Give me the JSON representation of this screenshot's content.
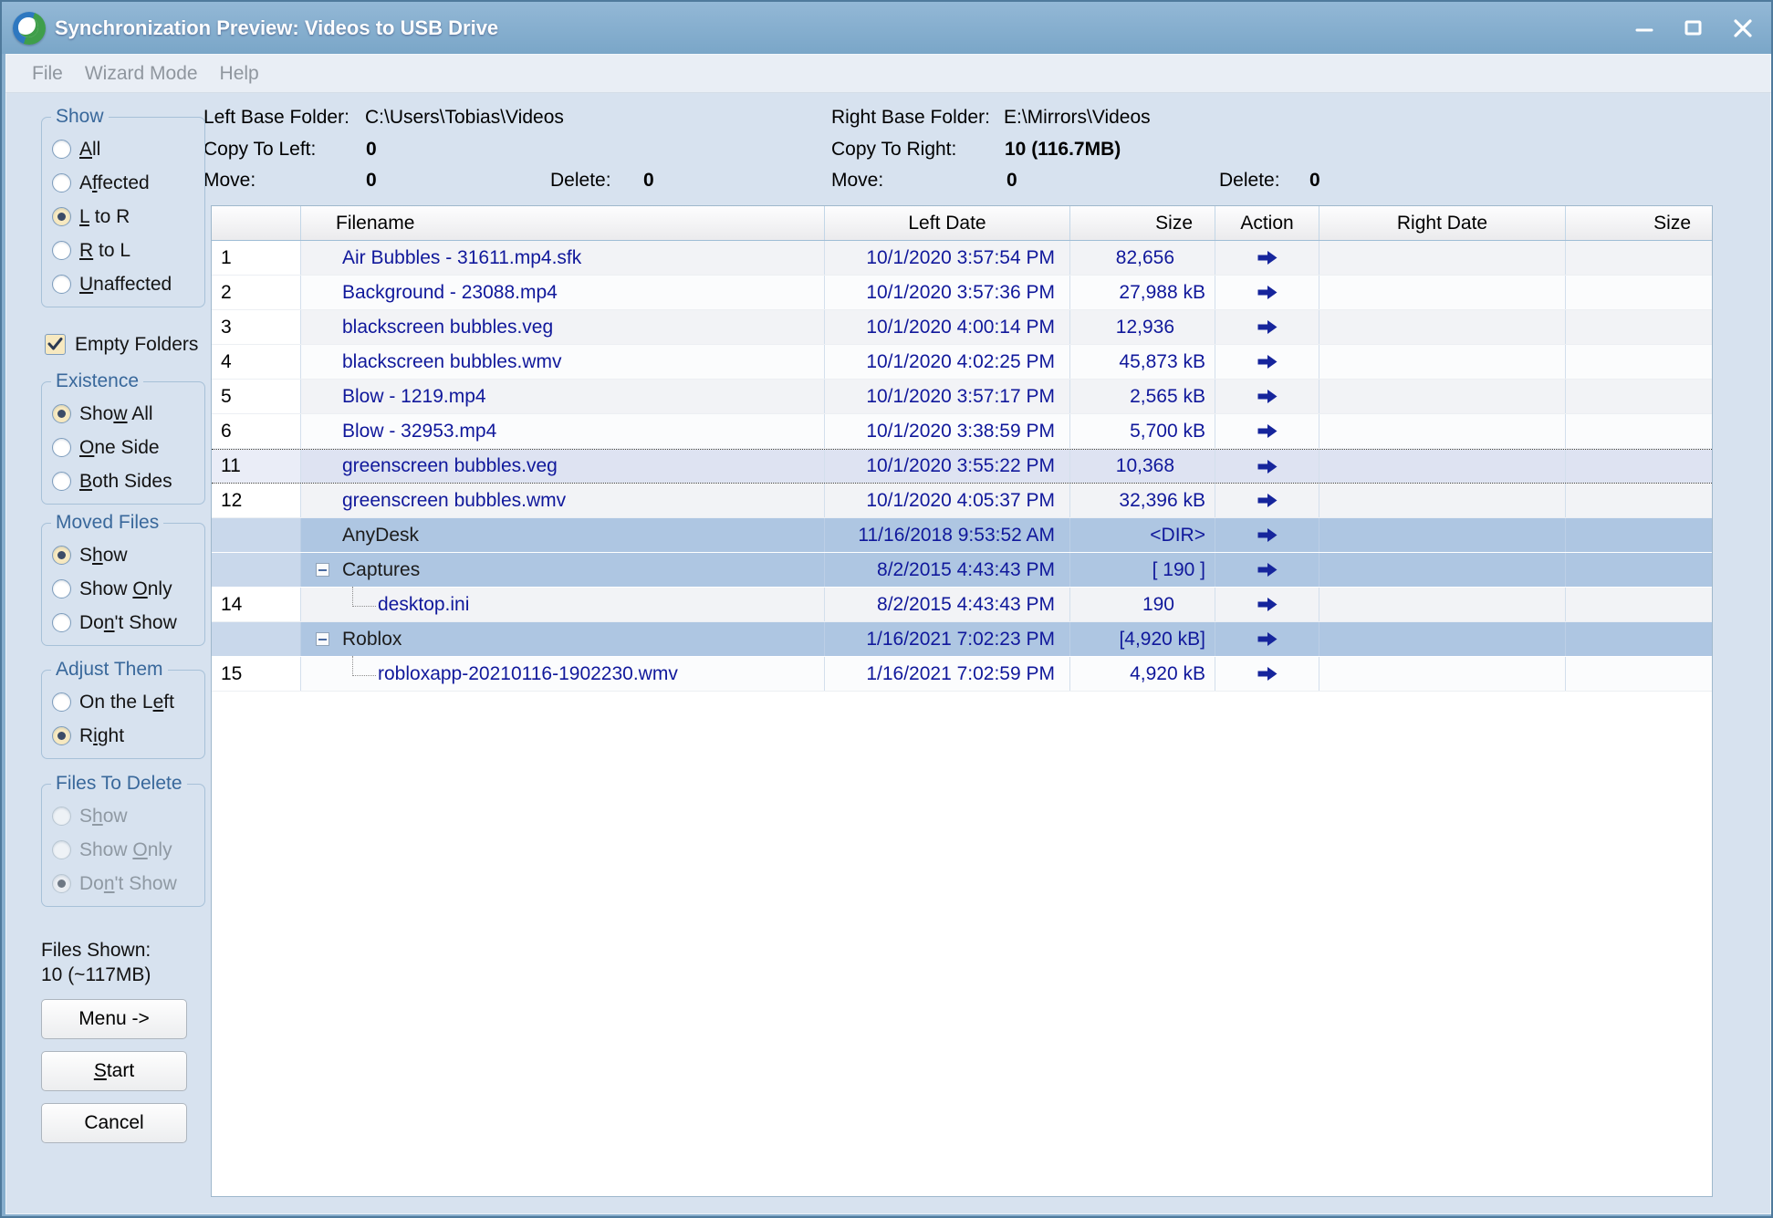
{
  "window": {
    "title": "Synchronization Preview: Videos to USB Drive"
  },
  "menu": {
    "items": [
      {
        "label": "File"
      },
      {
        "label": "Wizard Mode"
      },
      {
        "label": "Help"
      }
    ]
  },
  "info": {
    "left": {
      "base_label": "Left Base Folder:",
      "base_value": "C:\\Users\\Tobias\\Videos",
      "copy_label": "Copy To Left:",
      "copy_value": "0",
      "move_label": "Move:",
      "move_value": "0",
      "delete_label": "Delete:",
      "delete_value": "0"
    },
    "right": {
      "base_label": "Right Base Folder:",
      "base_value": "E:\\Mirrors\\Videos",
      "copy_label": "Copy To Right:",
      "copy_value": "10 (116.7MB)",
      "move_label": "Move:",
      "move_value": "0",
      "delete_label": "Delete:",
      "delete_value": "0"
    }
  },
  "sidebar": {
    "groups": [
      {
        "id": "show",
        "label": "Show",
        "disabled": false,
        "items": [
          {
            "label": "All",
            "ul": 0,
            "checked": false
          },
          {
            "label": "Affected",
            "ul": 1,
            "checked": false
          },
          {
            "label": "L to R",
            "ul": 0,
            "checked": true
          },
          {
            "label": "R to L",
            "ul": 0,
            "checked": false
          },
          {
            "label": "Unaffected",
            "ul": 0,
            "checked": false
          }
        ]
      },
      {
        "id": "existence",
        "label": "Existence",
        "disabled": false,
        "items": [
          {
            "label": "Show All",
            "ul": 3,
            "checked": true
          },
          {
            "label": "One Side",
            "ul": 0,
            "checked": false
          },
          {
            "label": "Both Sides",
            "ul": 0,
            "checked": false
          }
        ]
      },
      {
        "id": "moved-files",
        "label": "Moved Files",
        "disabled": false,
        "items": [
          {
            "label": "Show",
            "ul": 1,
            "checked": true
          },
          {
            "label": "Show Only",
            "ul": 5,
            "checked": false
          },
          {
            "label": "Don't Show",
            "ul": 2,
            "checked": false
          }
        ]
      },
      {
        "id": "adjust-them",
        "label": "Adjust Them",
        "disabled": false,
        "items": [
          {
            "label": "On the Left",
            "ul": 8,
            "checked": false
          },
          {
            "label": "Right",
            "ul": 1,
            "checked": true
          }
        ]
      },
      {
        "id": "files-to-delete",
        "label": "Files To Delete",
        "disabled": true,
        "items": [
          {
            "label": "Show",
            "ul": 1,
            "checked": false
          },
          {
            "label": "Show Only",
            "ul": 5,
            "checked": false
          },
          {
            "label": "Don't Show",
            "ul": 2,
            "checked": true
          }
        ]
      }
    ],
    "empty_folders": {
      "label": "Empty Folders",
      "checked": true
    },
    "files_shown_label": "Files Shown:",
    "files_shown_value": "10 (~117MB)",
    "buttons": [
      {
        "id": "menu",
        "label": "Menu ->"
      },
      {
        "id": "start",
        "label": "Start",
        "ul": 0
      },
      {
        "id": "cancel",
        "label": "Cancel"
      }
    ]
  },
  "table": {
    "headers": [
      "",
      "Filename",
      "Left Date",
      "Size",
      "Action",
      "Right Date",
      "Size"
    ],
    "rows": [
      {
        "num": "1",
        "name": "Air Bubbles - 31611.mp4.sfk",
        "type": "file",
        "shade": "a",
        "ldate": "10/1/2020 3:57:54 PM",
        "size": "82,656",
        "size_extra_pad": true,
        "action": "right",
        "rdate": "",
        "rsize": ""
      },
      {
        "num": "2",
        "name": "Background - 23088.mp4",
        "type": "file",
        "shade": "b",
        "ldate": "10/1/2020 3:57:36 PM",
        "size": "27,988 kB",
        "size_extra_pad": false,
        "action": "right",
        "rdate": "",
        "rsize": ""
      },
      {
        "num": "3",
        "name": "blackscreen bubbles.veg",
        "type": "file",
        "shade": "a",
        "ldate": "10/1/2020 4:00:14 PM",
        "size": "12,936",
        "size_extra_pad": true,
        "action": "right",
        "rdate": "",
        "rsize": ""
      },
      {
        "num": "4",
        "name": "blackscreen bubbles.wmv",
        "type": "file",
        "shade": "b",
        "ldate": "10/1/2020 4:02:25 PM",
        "size": "45,873 kB",
        "size_extra_pad": false,
        "action": "right",
        "rdate": "",
        "rsize": ""
      },
      {
        "num": "5",
        "name": "Blow - 1219.mp4",
        "type": "file",
        "shade": "a",
        "ldate": "10/1/2020 3:57:17 PM",
        "size": "2,565 kB",
        "size_extra_pad": false,
        "action": "right",
        "rdate": "",
        "rsize": ""
      },
      {
        "num": "6",
        "name": "Blow - 32953.mp4",
        "type": "file",
        "shade": "b",
        "ldate": "10/1/2020 3:38:59 PM",
        "size": "5,700 kB",
        "size_extra_pad": false,
        "action": "right",
        "rdate": "",
        "rsize": ""
      },
      {
        "num": "11",
        "name": "greenscreen bubbles.veg",
        "type": "file",
        "shade": "a",
        "selected": true,
        "ldate": "10/1/2020 3:55:22 PM",
        "size": "10,368",
        "size_extra_pad": true,
        "action": "right",
        "rdate": "",
        "rsize": ""
      },
      {
        "num": "12",
        "name": "greenscreen bubbles.wmv",
        "type": "file",
        "shade": "a",
        "ldate": "10/1/2020 4:05:37 PM",
        "size": "32,396 kB",
        "size_extra_pad": false,
        "action": "right",
        "rdate": "",
        "rsize": ""
      },
      {
        "num": "",
        "name": "AnyDesk",
        "type": "folder",
        "expander": false,
        "ldate": "11/16/2018 9:53:52 AM",
        "size": "<DIR>",
        "size_extra_pad": false,
        "action": "right",
        "rdate": "",
        "rsize": ""
      },
      {
        "num": "",
        "name": "Captures",
        "type": "folder",
        "expander": true,
        "ldate": "8/2/2015 4:43:43 PM",
        "size": "[ 190 ]",
        "size_extra_pad": false,
        "action": "right",
        "rdate": "",
        "rsize": ""
      },
      {
        "num": "14",
        "name": "desktop.ini",
        "type": "child",
        "shade": "a",
        "ldate": "8/2/2015 4:43:43 PM",
        "size": "190",
        "size_extra_pad": true,
        "action": "right",
        "rdate": "",
        "rsize": ""
      },
      {
        "num": "",
        "name": "Roblox",
        "type": "folder",
        "expander": true,
        "ldate": "1/16/2021 7:02:23 PM",
        "size": "[4,920 kB]",
        "size_extra_pad": false,
        "action": "right",
        "rdate": "",
        "rsize": ""
      },
      {
        "num": "15",
        "name": "robloxapp-20210116-1902230.wmv",
        "type": "child",
        "shade": "b",
        "ldate": "1/16/2021 7:02:59 PM",
        "size": "4,920 kB",
        "size_extra_pad": false,
        "action": "right",
        "rdate": "",
        "rsize": ""
      }
    ]
  },
  "colors": {
    "titlebar": "#7fa9cb",
    "client_bg": "#d7e2ef",
    "navy_text": "#10189b",
    "folder_row": "#aec6e2",
    "selected_row": "#dee3f2",
    "group_label": "#39689b",
    "radio_checked_fill": "#f7e9c0",
    "action_arrow": "#16259c"
  }
}
